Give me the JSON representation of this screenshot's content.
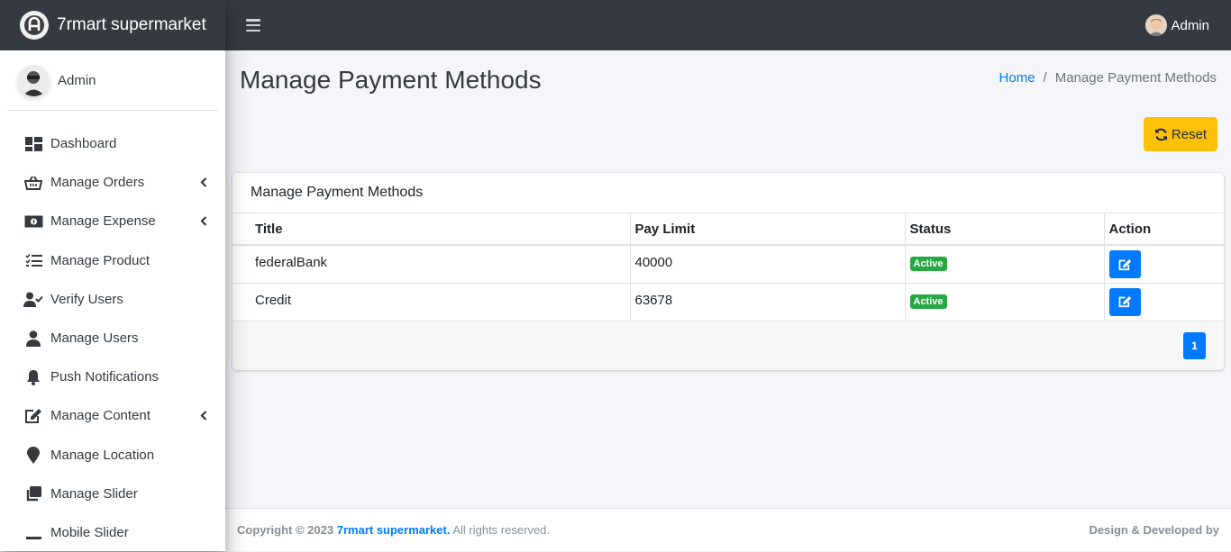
{
  "brand": {
    "name": "7rmart supermarket"
  },
  "sidebar": {
    "user_name": "Admin",
    "items": [
      {
        "label": "Dashboard",
        "icon": "dashboard-icon",
        "has_arrow": false
      },
      {
        "label": "Manage Orders",
        "icon": "basket-icon",
        "has_arrow": true
      },
      {
        "label": "Manage Expense",
        "icon": "money-bill-icon",
        "has_arrow": true
      },
      {
        "label": "Manage Product",
        "icon": "tasks-icon",
        "has_arrow": false
      },
      {
        "label": "Verify Users",
        "icon": "user-check-icon",
        "has_arrow": false
      },
      {
        "label": "Manage Users",
        "icon": "user-icon",
        "has_arrow": false
      },
      {
        "label": "Push Notifications",
        "icon": "bell-icon",
        "has_arrow": false
      },
      {
        "label": "Manage Content",
        "icon": "edit-icon",
        "has_arrow": true
      },
      {
        "label": "Manage Location",
        "icon": "map-marker-icon",
        "has_arrow": false
      },
      {
        "label": "Manage Slider",
        "icon": "clone-icon",
        "has_arrow": false
      },
      {
        "label": "Mobile Slider",
        "icon": "minus-icon",
        "has_arrow": false
      }
    ]
  },
  "topbar": {
    "user_name": "Admin"
  },
  "page": {
    "title": "Manage Payment Methods",
    "breadcrumb": {
      "home": "Home",
      "separator": "/",
      "current": "Manage Payment Methods"
    },
    "reset_label": "Reset"
  },
  "card": {
    "title": "Manage Payment Methods",
    "columns": [
      "Title",
      "Pay Limit",
      "Status",
      "Action"
    ],
    "rows": [
      {
        "title": "federalBank",
        "pay_limit": "40000",
        "status": "Active"
      },
      {
        "title": "Credit",
        "pay_limit": "63678",
        "status": "Active"
      }
    ],
    "pagination": {
      "current": "1"
    }
  },
  "footer": {
    "copyright_prefix": "Copyright © 2023",
    "brand": "7rmart supermarket.",
    "rights": "All rights reserved.",
    "right_text": "Design & Developed by"
  },
  "colors": {
    "primary": "#007bff",
    "warning": "#ffc107",
    "success": "#28a745",
    "dark": "#343a40"
  }
}
